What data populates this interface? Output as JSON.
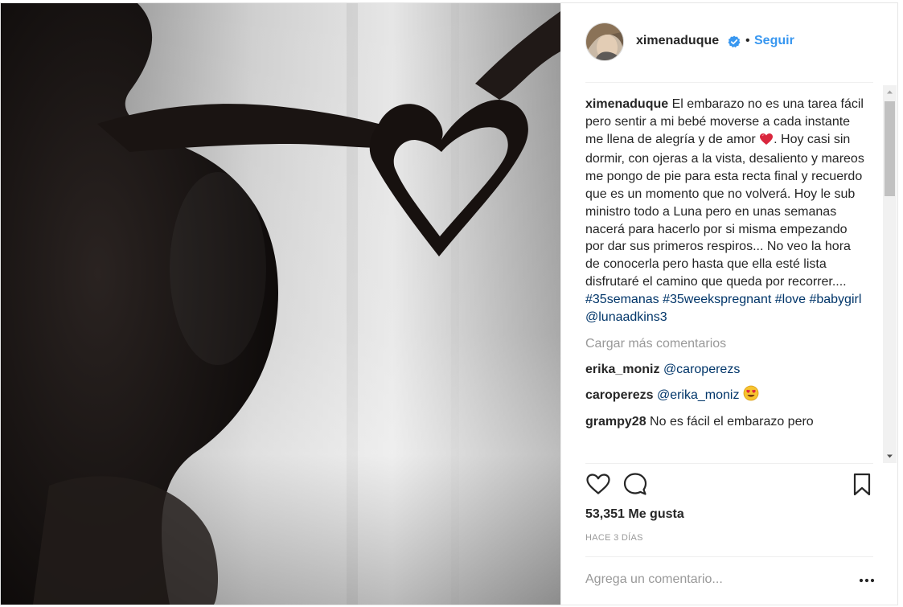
{
  "post": {
    "image_alt": "Silueta de mujer embarazada formando un corazón con las manos"
  },
  "header": {
    "username": "ximenaduque",
    "separator": "•",
    "follow_label": "Seguir"
  },
  "caption": {
    "username": "ximenaduque",
    "text_before_emoji": "El embarazo no es una tarea fácil pero sentir a mi bebé moverse a cada instante me llena de alegría y de amor",
    "text_after_emoji": ". Hoy casi sin dormir, con ojeras a la vista, desaliento y mareos me pongo de pie para esta recta final y recuerdo que es un momento que no volverá. Hoy le sub ministro todo a Luna pero en unas semanas nacerá para hacerlo por si misma empezando por dar sus primeros respiros... No veo la hora de conocerla pero hasta que ella esté lista disfrutaré el camino que queda por recorrer....",
    "hashtag_1": "#35semanas",
    "hashtag_2": "#35weekspregnant",
    "hashtag_3": "#love",
    "hashtag_4": "#babygirl",
    "mention": "@lunaadkins3"
  },
  "load_more": "Cargar más comentarios",
  "comments": [
    {
      "username": "erika_moniz",
      "text": "@caroperezs"
    },
    {
      "username": "caroperezs",
      "text": "@erika_moniz"
    },
    {
      "username": "grampy28",
      "text": "No es fácil el embarazo pero"
    }
  ],
  "likes": {
    "text": "53,351 Me gusta"
  },
  "timestamp": "Hace 3 días",
  "add_comment": {
    "placeholder": "Agrega un comentario..."
  },
  "icons": {
    "like": "heart-outline-icon",
    "comment": "speech-bubble-icon",
    "save": "bookmark-icon",
    "verified": "verified-badge-icon",
    "options": "more-options-icon"
  },
  "colors": {
    "link_blue": "#3897f0",
    "hashtag_navy": "#003569",
    "muted": "#999999",
    "text": "#262626"
  }
}
